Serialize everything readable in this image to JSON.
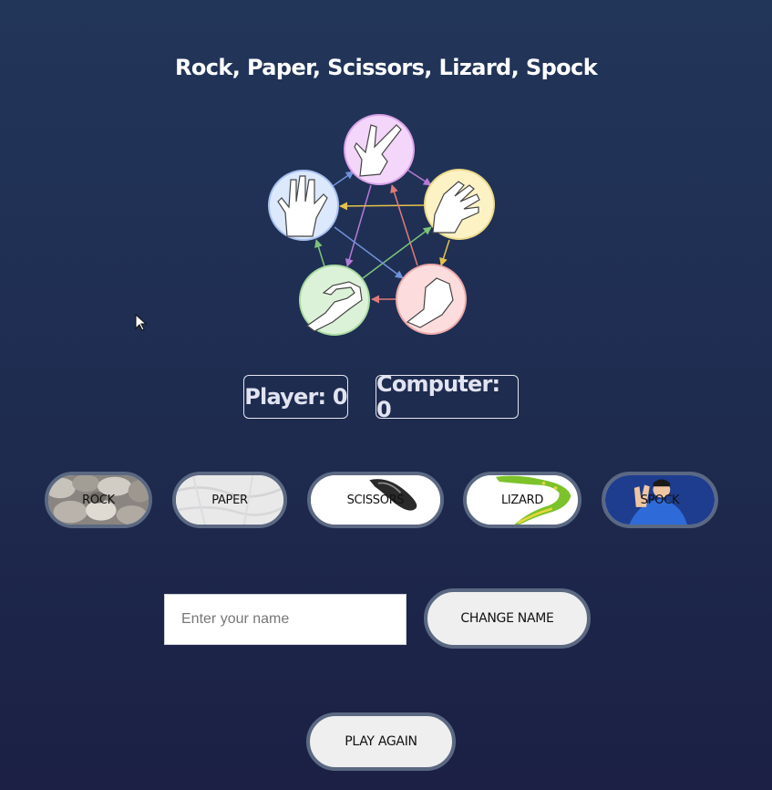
{
  "title": "Rock, Paper, Scissors, Lizard, Spock",
  "scores": {
    "player": "Player: 0",
    "computer": "Computer: 0"
  },
  "choices": [
    {
      "label": "ROCK",
      "image": "rock-photo"
    },
    {
      "label": "PAPER",
      "image": "paper-texture"
    },
    {
      "label": "SCISSORS",
      "image": "scissors-photo"
    },
    {
      "label": "LIZARD",
      "image": "lizard-illustration"
    },
    {
      "label": "SPOCK",
      "image": "spock-illustration"
    }
  ],
  "name_input": {
    "placeholder": "Enter your name",
    "value": ""
  },
  "buttons": {
    "change_name": "CHANGE NAME",
    "play_again": "PLAY AGAIN"
  },
  "diagram": {
    "nodes": [
      {
        "name": "scissors",
        "icon": "scissors-hand-icon",
        "fill": "#f3d6fa",
        "stroke": "#d9a3e8"
      },
      {
        "name": "paper",
        "icon": "paper-hand-icon",
        "fill": "#fcf2c4",
        "stroke": "#ecd98a"
      },
      {
        "name": "rock",
        "icon": "rock-hand-icon",
        "fill": "#fcdcdc",
        "stroke": "#efaaaa"
      },
      {
        "name": "lizard",
        "icon": "lizard-hand-icon",
        "fill": "#dcf2d8",
        "stroke": "#a9dba2"
      },
      {
        "name": "spock",
        "icon": "spock-hand-icon",
        "fill": "#dce8fc",
        "stroke": "#a7c1ee"
      }
    ],
    "arrow_colors": {
      "scissors": "#b57ad8",
      "paper": "#e6c24a",
      "rock": "#e07a7a",
      "lizard": "#7cc47a",
      "spock": "#6f93da"
    }
  }
}
